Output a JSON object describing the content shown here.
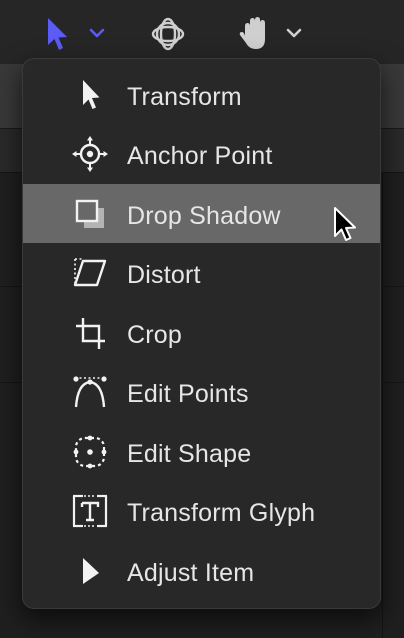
{
  "toolbar": {
    "tools": [
      {
        "icon": "select-arrow-icon",
        "color": "#5b5cf5"
      },
      {
        "icon": "3d-transform-icon",
        "color": "#cfcfcf"
      },
      {
        "icon": "hand-pan-icon",
        "color": "#cfcfcf"
      }
    ]
  },
  "menu": {
    "items": [
      {
        "label": "Transform",
        "icon": "arrow-pointer-icon"
      },
      {
        "label": "Anchor Point",
        "icon": "anchor-point-icon"
      },
      {
        "label": "Drop Shadow",
        "icon": "drop-shadow-icon",
        "highlighted": true
      },
      {
        "label": "Distort",
        "icon": "distort-icon"
      },
      {
        "label": "Crop",
        "icon": "crop-icon"
      },
      {
        "label": "Edit Points",
        "icon": "edit-points-icon"
      },
      {
        "label": "Edit Shape",
        "icon": "edit-shape-icon"
      },
      {
        "label": "Transform Glyph",
        "icon": "transform-glyph-icon"
      },
      {
        "label": "Adjust Item",
        "icon": "adjust-item-icon"
      }
    ]
  },
  "colors": {
    "accent": "#5b5cf5",
    "menu_bg": "#282828",
    "highlight_bg": "#686868",
    "text": "#e6e6e6"
  }
}
